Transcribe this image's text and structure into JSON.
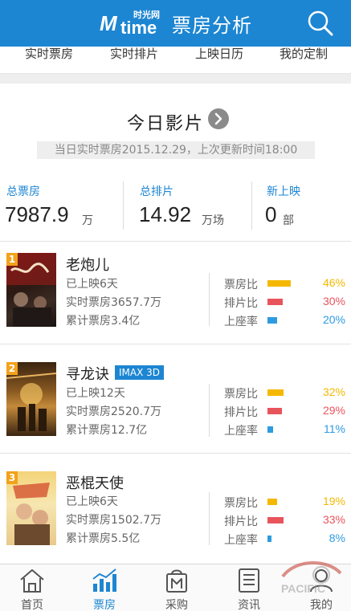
{
  "header": {
    "logo_small": "时光网",
    "logo_word": "time",
    "title": "票房分析"
  },
  "tabs": [
    "实时票房",
    "实时排片",
    "上映日历",
    "我的定制"
  ],
  "today": {
    "title": "今日影片",
    "update_text": "当日实时票房2015.12.29，上次更新时间18:00"
  },
  "stats": [
    {
      "label": "总票房",
      "value": "7987.9",
      "unit": "万"
    },
    {
      "label": "总排片",
      "value": "14.92",
      "unit": "万场"
    },
    {
      "label": "新上映",
      "value": "0",
      "unit": "部"
    }
  ],
  "movies": [
    {
      "rank": "1",
      "title": "老炮儿",
      "badge": "",
      "days": "已上映6天",
      "realtime": "实时票房3657.7万",
      "total": "累计票房3.4亿",
      "metrics": [
        {
          "label": "票房比",
          "value": "46%",
          "fraction": 0.46,
          "color": "#f5b800"
        },
        {
          "label": "排片比",
          "value": "30%",
          "fraction": 0.3,
          "color": "#e8545c"
        },
        {
          "label": "上座率",
          "value": "20%",
          "fraction": 0.2,
          "color": "#2e9be0"
        }
      ]
    },
    {
      "rank": "2",
      "title": "寻龙诀",
      "badge": "IMAX 3D",
      "days": "已上映12天",
      "realtime": "实时票房2520.7万",
      "total": "累计票房12.7亿",
      "metrics": [
        {
          "label": "票房比",
          "value": "32%",
          "fraction": 0.32,
          "color": "#f5b800"
        },
        {
          "label": "排片比",
          "value": "29%",
          "fraction": 0.29,
          "color": "#e8545c"
        },
        {
          "label": "上座率",
          "value": "11%",
          "fraction": 0.11,
          "color": "#2e9be0"
        }
      ]
    },
    {
      "rank": "3",
      "title": "恶棍天使",
      "badge": "",
      "days": "已上映6天",
      "realtime": "实时票房1502.7万",
      "total": "累计票房5.5亿",
      "metrics": [
        {
          "label": "票房比",
          "value": "19%",
          "fraction": 0.19,
          "color": "#f5b800"
        },
        {
          "label": "排片比",
          "value": "33%",
          "fraction": 0.33,
          "color": "#e8545c"
        },
        {
          "label": "上座率",
          "value": "8%",
          "fraction": 0.08,
          "color": "#2e9be0"
        }
      ]
    }
  ],
  "nav": [
    {
      "label": "首页",
      "icon": "home-icon"
    },
    {
      "label": "票房",
      "icon": "bar-chart-icon"
    },
    {
      "label": "采购",
      "icon": "shopping-bag-icon"
    },
    {
      "label": "资讯",
      "icon": "news-icon"
    },
    {
      "label": "我的",
      "icon": "user-icon"
    }
  ],
  "watermark": "PACIFIC"
}
